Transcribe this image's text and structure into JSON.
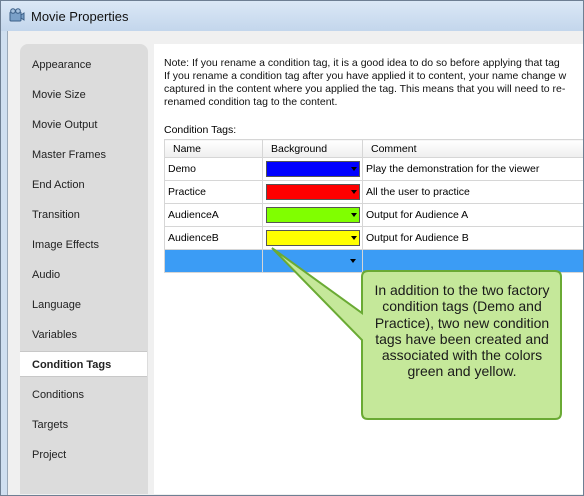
{
  "window": {
    "title": "Movie Properties"
  },
  "sidebar": {
    "items": [
      {
        "label": "Appearance"
      },
      {
        "label": "Movie Size"
      },
      {
        "label": "Movie Output"
      },
      {
        "label": "Master Frames"
      },
      {
        "label": "End Action"
      },
      {
        "label": "Transition"
      },
      {
        "label": "Image Effects"
      },
      {
        "label": "Audio"
      },
      {
        "label": "Language"
      },
      {
        "label": "Variables"
      },
      {
        "label": "Condition Tags",
        "selected": true
      },
      {
        "label": "Conditions"
      },
      {
        "label": "Targets"
      },
      {
        "label": "Project"
      }
    ]
  },
  "main": {
    "note": "Note: If you rename a condition tag, it is a good idea to do so before applying that tag\nIf you rename a condition tag after you have applied it to content, your name change w\ncaptured in the content where you applied the tag. This means that you will need to re-\nrenamed condition tag to the content.",
    "tags_label": "Condition Tags:",
    "columns": [
      "Name",
      "Background",
      "Comment"
    ],
    "rows": [
      {
        "name": "Demo",
        "color": "#0000ff",
        "comment": "Play the demonstration for the viewer"
      },
      {
        "name": "Practice",
        "color": "#ff0000",
        "comment": "All the user to practice"
      },
      {
        "name": "AudienceA",
        "color": "#80ff00",
        "comment": "Output for Audience A"
      },
      {
        "name": "AudienceB",
        "color": "#ffff00",
        "comment": "Output for Audience B"
      }
    ]
  },
  "callout": {
    "text": "In addition to the two factory condition tags (Demo and Practice), two new condition tags have been created and associated with the colors green and yellow.",
    "fill": "#c5e89a",
    "border": "#6aaa34"
  }
}
